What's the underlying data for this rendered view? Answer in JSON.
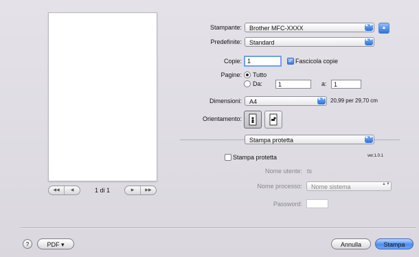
{
  "preview": {
    "nav_first": "◀◀",
    "nav_prev": "◀",
    "nav_next": "▶",
    "nav_last": "▶▶",
    "page_text": "1 di 1"
  },
  "printer": {
    "label": "Stampante:",
    "value": "Brother MFC-XXXX"
  },
  "presets": {
    "label": "Predefinite:",
    "value": "Standard"
  },
  "copies": {
    "label": "Copie:",
    "value": "1",
    "collate_label": "Fascicola copie",
    "collate_checked": true
  },
  "pages": {
    "label": "Pagine:",
    "all_label": "Tutto",
    "from_label": "Da:",
    "from_value": "1",
    "to_label": "a:",
    "to_value": "1"
  },
  "paper": {
    "label": "Dimensioni:",
    "value": "A4",
    "size_text": "20,99 per 29,70 cm"
  },
  "orientation": {
    "label": "Orientamento:"
  },
  "panel": {
    "value": "Stampa protetta"
  },
  "secure": {
    "version": "ver.1.0.1",
    "checkbox_label": "Stampa protetta",
    "user_label": "Nome utente:",
    "user_value": "ts",
    "job_label": "Nome processo:",
    "job_value": "Nome sistema",
    "password_label": "Password:",
    "password_value": ""
  },
  "footer": {
    "help_symbol": "?",
    "pdf_label": "PDF ▾",
    "cancel_label": "Annulla",
    "print_label": "Stampa"
  },
  "icons": {
    "popup_arrows": "▲▼",
    "disclosure": "▲",
    "checkmark": "✓"
  },
  "colors": {
    "accent": "#3b7ae0",
    "panel_bg": "#dfdce4"
  }
}
